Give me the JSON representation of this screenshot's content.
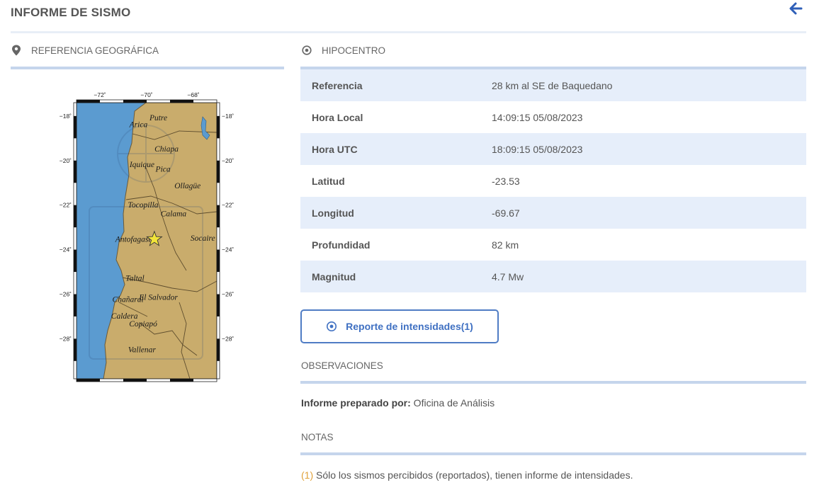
{
  "title": "INFORME DE SISMO",
  "icons": {
    "back": "arrow-left-icon",
    "location": "map-pin-icon",
    "target": "target-icon"
  },
  "colors": {
    "accent": "#3f70c2",
    "rule": "#c5d5ec",
    "row_alt": "#e6eefa",
    "note_number": "#e0a13a",
    "ocean": "#5b9bd0",
    "land": "#c9ac6c",
    "epicenter": "#f2e43a"
  },
  "geo": {
    "heading": "REFERENCIA GEOGRÁFICA",
    "map": {
      "lon_ticks": [
        "−72˚",
        "−70˚",
        "−68˚"
      ],
      "lat_ticks": [
        "−18˚",
        "−20˚",
        "−22˚",
        "−24˚",
        "−26˚",
        "−28˚"
      ],
      "lon_range": [
        -73,
        -67
      ],
      "lat_range": [
        -17.4,
        -29.8
      ],
      "epicenter": {
        "lat": -23.53,
        "lon": -69.67
      },
      "places": [
        {
          "name": "Arica",
          "lat": -18.5,
          "lon": -70.35
        },
        {
          "name": "Putre",
          "lat": -18.2,
          "lon": -69.5
        },
        {
          "name": "Chiapa",
          "lat": -19.6,
          "lon": -69.15
        },
        {
          "name": "Iquique",
          "lat": -20.3,
          "lon": -70.2
        },
        {
          "name": "Pica",
          "lat": -20.5,
          "lon": -69.3
        },
        {
          "name": "Ollagüe",
          "lat": -21.25,
          "lon": -68.25
        },
        {
          "name": "Tocopilla",
          "lat": -22.1,
          "lon": -70.15
        },
        {
          "name": "Calama",
          "lat": -22.5,
          "lon": -68.85
        },
        {
          "name": "Antofagasta",
          "lat": -23.65,
          "lon": -70.5
        },
        {
          "name": "Socaire",
          "lat": -23.6,
          "lon": -67.6
        },
        {
          "name": "Taltal",
          "lat": -25.4,
          "lon": -70.5
        },
        {
          "name": "Chañaral",
          "lat": -26.35,
          "lon": -70.8
        },
        {
          "name": "El Salvador",
          "lat": -26.25,
          "lon": -69.5
        },
        {
          "name": "Caldera",
          "lat": -27.1,
          "lon": -70.95
        },
        {
          "name": "Copiapó",
          "lat": -27.45,
          "lon": -70.15
        },
        {
          "name": "Vallenar",
          "lat": -28.6,
          "lon": -70.2
        }
      ]
    }
  },
  "hypocenter": {
    "heading": "HIPOCENTRO",
    "rows": [
      {
        "label": "Referencia",
        "value": "28 km al SE de Baquedano"
      },
      {
        "label": "Hora Local",
        "value": "14:09:15 05/08/2023"
      },
      {
        "label": "Hora UTC",
        "value": "18:09:15 05/08/2023"
      },
      {
        "label": "Latitud",
        "value": "-23.53"
      },
      {
        "label": "Longitud",
        "value": "-69.67"
      },
      {
        "label": "Profundidad",
        "value": "82 km"
      },
      {
        "label": "Magnitud",
        "value": "4.7 Mw"
      }
    ],
    "report_button": "Reporte de intensidades(1)"
  },
  "observations": {
    "heading": "OBSERVACIONES",
    "prepared_label": "Informe preparado por:",
    "prepared_value": " Oficina de Análisis"
  },
  "notes": {
    "heading": "NOTAS",
    "number": "(1)",
    "text": " Sólo los sismos percibidos (reportados), tienen informe de intensidades."
  }
}
